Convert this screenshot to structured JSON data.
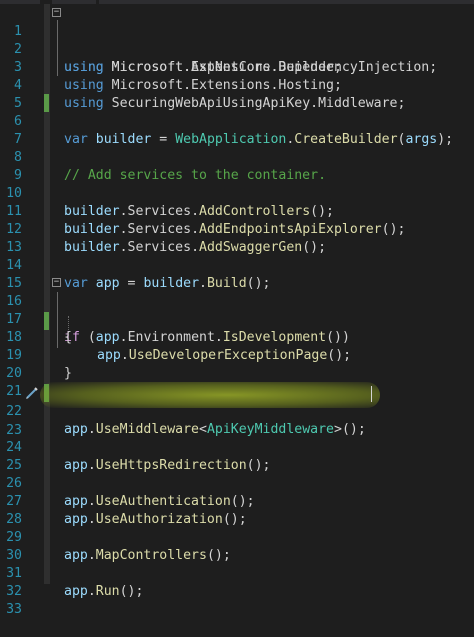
{
  "colors": {
    "background": "#1e1e1e",
    "line_number": "#2b91af",
    "keyword": "#569cd6",
    "control_keyword": "#d8a0df",
    "type": "#4ec9b0",
    "method": "#dcdcaa",
    "variable": "#9cdcfe",
    "comment": "#57a64a",
    "change_mark": "#5a9a48",
    "highlight": "#b4c828"
  },
  "line_numbers": [
    "1",
    "2",
    "3",
    "4",
    "5",
    "6",
    "7",
    "8",
    "9",
    "10",
    "11",
    "12",
    "13",
    "14",
    "15",
    "16",
    "17",
    "18",
    "19",
    "20",
    "21",
    "22",
    "23",
    "24",
    "25",
    "26",
    "27",
    "28",
    "29",
    "30",
    "31",
    "32",
    "33"
  ],
  "code": {
    "l1": {
      "kw": "using",
      "ns": "Microsoft.AspNetCore.Builder;"
    },
    "l2": {
      "kw": "using",
      "ns": "Microsoft.Extensions.DependencyInjection;"
    },
    "l3": {
      "kw": "using",
      "ns": "Microsoft.Extensions.Hosting;"
    },
    "l4": {
      "kw": "using",
      "ns": "SecuringWebApiUsingApiKey.Middleware;"
    },
    "l6": {
      "kw": "var",
      "var": "builder",
      "eq": " = ",
      "type": "WebApplication",
      "dot": ".",
      "method": "CreateBuilder",
      "open": "(",
      "arg": "args",
      "close": ");"
    },
    "l8": {
      "comment": "// Add services to the container."
    },
    "l10": {
      "obj": "builder",
      "p1": ".",
      "prop": "Services",
      "p2": ".",
      "method": "AddControllers",
      "tail": "();"
    },
    "l11": {
      "obj": "builder",
      "p1": ".",
      "prop": "Services",
      "p2": ".",
      "method": "AddEndpointsApiExplorer",
      "tail": "();"
    },
    "l12": {
      "obj": "builder",
      "p1": ".",
      "prop": "Services",
      "p2": ".",
      "method": "AddSwaggerGen",
      "tail": "();"
    },
    "l14": {
      "kw": "var",
      "var": "app",
      "eq": " = ",
      "obj": "builder",
      "dot": ".",
      "method": "Build",
      "tail": "();"
    },
    "l16": {
      "kw": "if",
      "open": " (",
      "obj": "app",
      "p1": ".",
      "prop": "Environment",
      "p2": ".",
      "method": "IsDevelopment",
      "tail": "())"
    },
    "l17": {
      "brace": "{"
    },
    "l18": {
      "obj": "app",
      "dot": ".",
      "method": "UseDeveloperExceptionPage",
      "tail": "();"
    },
    "l19": {
      "brace": "}"
    },
    "l22": {
      "obj": "app",
      "dot": ".",
      "method": "UseMiddleware",
      "lt": "<",
      "type": "ApiKeyMiddleware",
      "gt": ">",
      "tail": "();"
    },
    "l24": {
      "obj": "app",
      "dot": ".",
      "method": "UseHttpsRedirection",
      "tail": "();"
    },
    "l26": {
      "obj": "app",
      "dot": ".",
      "method": "UseAuthentication",
      "tail": "();"
    },
    "l27": {
      "obj": "app",
      "dot": ".",
      "method": "UseAuthorization",
      "tail": "();"
    },
    "l29": {
      "obj": "app",
      "dot": ".",
      "method": "MapControllers",
      "tail": "();"
    },
    "l31": {
      "obj": "app",
      "dot": ".",
      "method": "Run",
      "tail": "();"
    }
  }
}
